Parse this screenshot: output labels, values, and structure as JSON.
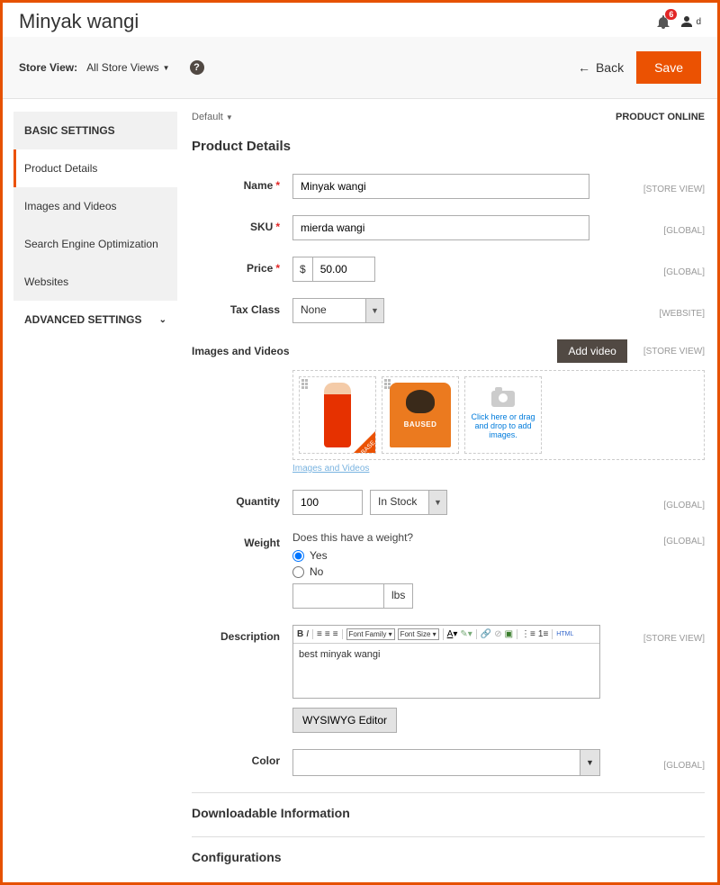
{
  "header": {
    "title": "Minyak wangi",
    "notification_count": "6",
    "user_initial": "d"
  },
  "toolbar": {
    "store_view_label": "Store View:",
    "store_view_value": "All Store Views",
    "back_label": "Back",
    "save_label": "Save"
  },
  "sidebar": {
    "basic_label": "BASIC SETTINGS",
    "advanced_label": "ADVANCED SETTINGS",
    "items": {
      "product_details": "Product Details",
      "images": "Images and Videos",
      "seo": "Search Engine Optimization",
      "websites": "Websites"
    }
  },
  "content": {
    "default_label": "Default",
    "status": "PRODUCT ONLINE",
    "section_title": "Product Details",
    "scope": {
      "store_view": "[STORE VIEW]",
      "global": "[GLOBAL]",
      "website": "[WEBSITE]"
    },
    "labels": {
      "name": "Name",
      "sku": "SKU",
      "price": "Price",
      "tax": "Tax Class",
      "images": "Images and Videos",
      "quantity": "Quantity",
      "weight": "Weight",
      "description": "Description",
      "color": "Color"
    },
    "name_value": "Minyak wangi",
    "sku_value": "mierda wangi",
    "price_currency": "$",
    "price_value": "50.00",
    "tax_value": "None",
    "add_video": "Add video",
    "drop_text": "Click here or drag and drop to add images.",
    "images_link": "Images and Videos",
    "base_tag": "BASE",
    "qty_value": "100",
    "stock_value": "In Stock",
    "weight_question": "Does this have a weight?",
    "weight_yes": "Yes",
    "weight_no": "No",
    "weight_unit": "lbs",
    "editor_fontfamily": "Font Family",
    "editor_fontsize": "Font Size",
    "editor_html": "HTML",
    "description_value": "best minyak wangi",
    "wysiwyg_label": "WYSIWYG Editor",
    "downloadable": "Downloadable Information",
    "configurations": "Configurations"
  }
}
